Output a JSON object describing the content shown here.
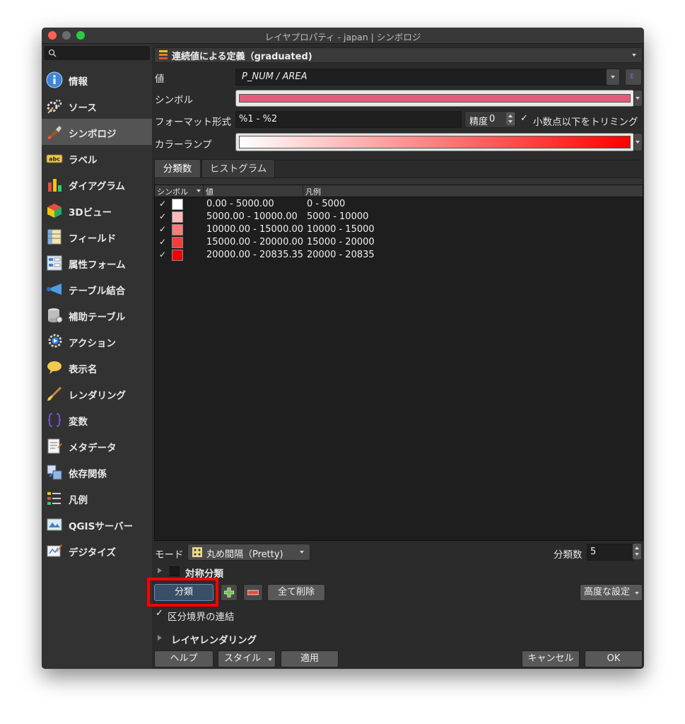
{
  "window": {
    "title": "レイヤプロパティ - japan | シンボロジ"
  },
  "sidebar": {
    "items": [
      {
        "label": "情報",
        "icon": "info-icon"
      },
      {
        "label": "ソース",
        "icon": "source-icon"
      },
      {
        "label": "シンボロジ",
        "icon": "paintbrush-icon"
      },
      {
        "label": "ラベル",
        "icon": "label-abc-icon"
      },
      {
        "label": "ダイアグラム",
        "icon": "diagram-icon"
      },
      {
        "label": "3Dビュー",
        "icon": "cube-3d-icon"
      },
      {
        "label": "フィールド",
        "icon": "field-icon"
      },
      {
        "label": "属性フォーム",
        "icon": "form-icon"
      },
      {
        "label": "テーブル結合",
        "icon": "join-icon"
      },
      {
        "label": "補助テーブル",
        "icon": "database-icon"
      },
      {
        "label": "アクション",
        "icon": "action-gear-icon"
      },
      {
        "label": "表示名",
        "icon": "speech-bubble-icon"
      },
      {
        "label": "レンダリング",
        "icon": "brush-icon"
      },
      {
        "label": "変数",
        "icon": "variable-icon"
      },
      {
        "label": "メタデータ",
        "icon": "metadata-icon"
      },
      {
        "label": "依存関係",
        "icon": "dependency-icon"
      },
      {
        "label": "凡例",
        "icon": "legend-icon"
      },
      {
        "label": "QGISサーバー",
        "icon": "server-icon"
      },
      {
        "label": "デジタイズ",
        "icon": "digitize-icon"
      }
    ],
    "selected_index": 2
  },
  "renderer": {
    "label": "連続値による定義（graduated)"
  },
  "value_row": {
    "label": "値",
    "expression": "P_NUM / AREA"
  },
  "symbol_row": {
    "label": "シンボル",
    "color": "#e85a7a"
  },
  "format_row": {
    "label": "フォーマット形式",
    "value": "%1 - %2",
    "precision_label": "精度",
    "precision_value": "0",
    "trim_label": "小数点以下をトリミング"
  },
  "ramp_row": {
    "label": "カラーランプ",
    "start_color": "#ffffff",
    "end_color": "#ff0000"
  },
  "tabs": [
    {
      "label": "分類数"
    },
    {
      "label": "ヒストグラム"
    }
  ],
  "table": {
    "headers": {
      "symbol": "シンボル",
      "value": "値",
      "legend": "凡例"
    },
    "rows": [
      {
        "color": "#ffffff",
        "value": "0.00 - 5000.00",
        "legend": "0 - 5000"
      },
      {
        "color": "#fcbaba",
        "value": "5000.00 - 10000.00",
        "legend": "5000 - 10000"
      },
      {
        "color": "#fb7a7a",
        "value": "10000.00 - 15000.00",
        "legend": "10000 - 15000"
      },
      {
        "color": "#f83c3c",
        "value": "15000.00 - 20000.00",
        "legend": "15000 - 20000"
      },
      {
        "color": "#f40000",
        "value": "20000.00 - 20835.35",
        "legend": "20000 - 20835"
      }
    ]
  },
  "mode": {
    "label": "モード",
    "value": "丸め間隔（Pretty)"
  },
  "classes": {
    "label": "分類数",
    "value": "5"
  },
  "symmetric": {
    "label": "対称分類"
  },
  "buttons": {
    "classify": "分類",
    "delete_all": "全て削除",
    "advanced": "高度な設定"
  },
  "link_bounds": {
    "label": "区分境界の連結"
  },
  "layer_rendering": {
    "label": "レイヤレンダリング"
  },
  "footer": {
    "help": "ヘルプ",
    "style": "スタイル",
    "apply": "適用",
    "cancel": "キャンセル",
    "ok": "OK"
  },
  "highlight": {
    "color": "#ff0000"
  }
}
